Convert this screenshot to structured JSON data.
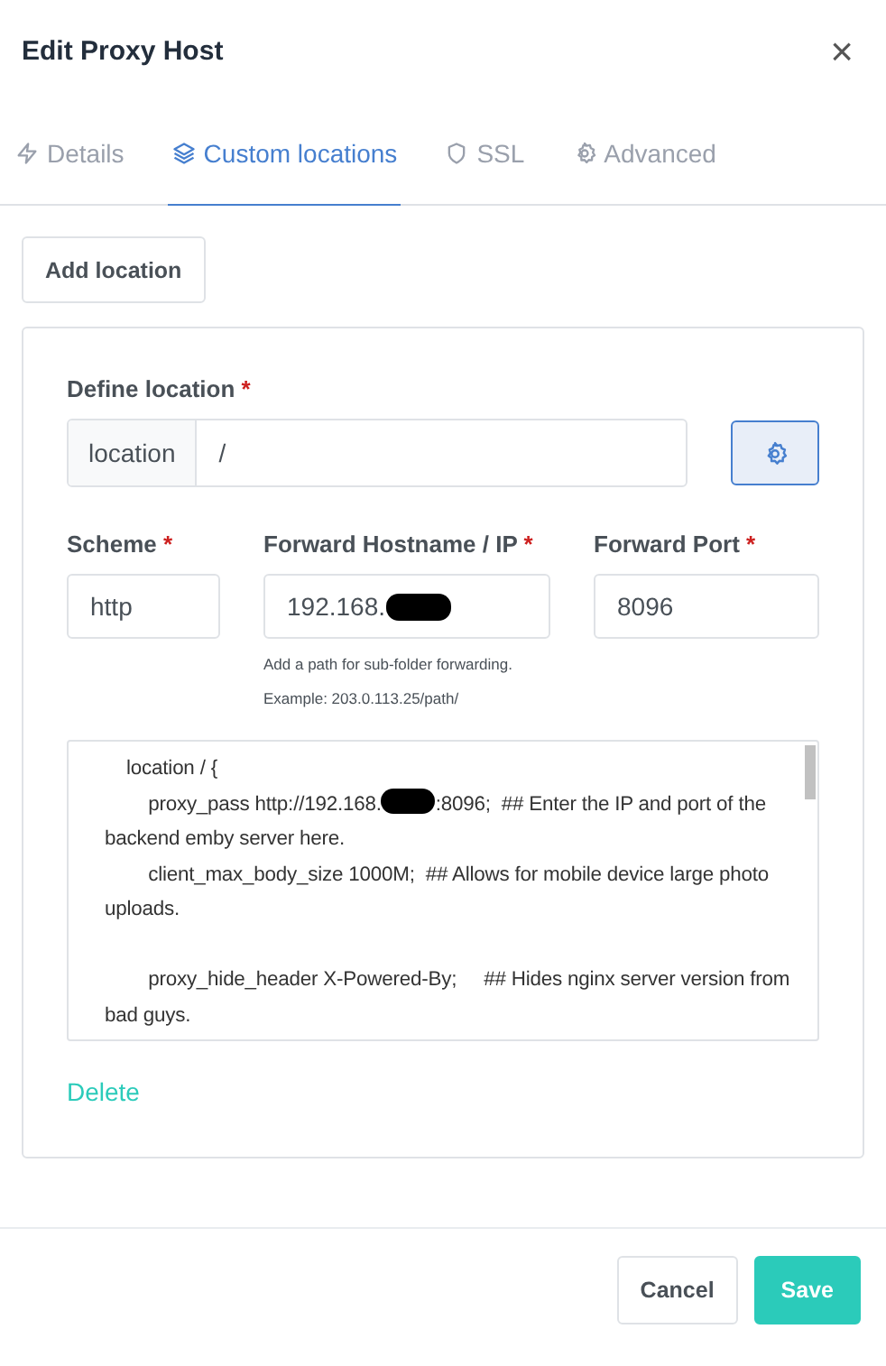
{
  "window": {
    "title": "Edit Proxy Host",
    "close": "×"
  },
  "tabs": [
    {
      "label": "Details",
      "kind": "bolt",
      "selected": false
    },
    {
      "label": "Custom locations",
      "kind": "layers",
      "selected": true
    },
    {
      "label": "SSL",
      "kind": "shield",
      "selected": false
    },
    {
      "label": "Advanced",
      "kind": "gear",
      "selected": false
    }
  ],
  "add_button": "Add location",
  "location": {
    "label": "Define location",
    "required": "*",
    "addon": "location",
    "value": "/"
  },
  "fields": [
    {
      "label": "Scheme",
      "required": "*",
      "value": "http",
      "redacted": false
    },
    {
      "label": "Forward Hostname / IP",
      "required": "*",
      "value": "192.168.",
      "redacted": true,
      "help": [
        "Add a path for sub-folder forwarding.",
        "Example: 203.0.113.25/path/"
      ]
    },
    {
      "label": "Forward Port",
      "required": "*",
      "value": "8096",
      "redacted": false
    }
  ],
  "config_lines": [
    {
      "parts": [
        "    location / {"
      ]
    },
    {
      "parts": [
        "        proxy_pass http://192.168.",
        ":8096;  ## Enter the IP and port of the backend emby server here."
      ]
    },
    {
      "parts": [
        "        client_max_body_size 1000M;  ## Allows for mobile device large photo uploads."
      ]
    },
    {
      "kind": "blank"
    },
    {
      "parts": [
        "        proxy_hide_header X-Powered-By;     ## Hides nginx server version from bad guys."
      ]
    }
  ],
  "delete_link": "Delete",
  "buttons": [
    {
      "label": "Cancel",
      "kind": "secondary"
    },
    {
      "label": "Save",
      "kind": "primary"
    }
  ]
}
